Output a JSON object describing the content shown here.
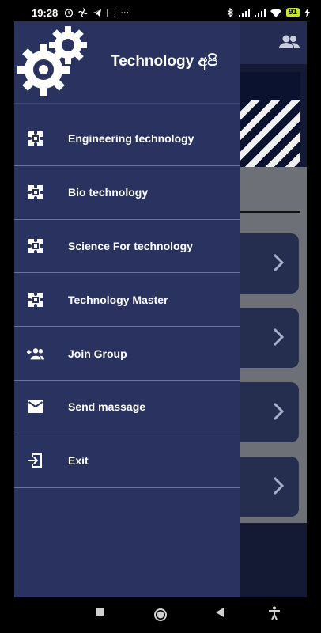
{
  "status_bar": {
    "time": "19:28",
    "left_icons": [
      "alarm-icon",
      "fan-icon",
      "telegram-icon",
      "app-icon",
      "more-icon"
    ],
    "more": "···",
    "battery": "91",
    "right_icons": [
      "bluetooth-icon",
      "signal-icon",
      "signal-icon",
      "wifi-icon",
      "battery-icon",
      "charging-icon"
    ]
  },
  "drawer": {
    "title": "Technology අපි",
    "logo": "gears-logo",
    "items": [
      {
        "label": "Engineering technology",
        "icon": "puzzle-icon"
      },
      {
        "label": "Bio technology",
        "icon": "puzzle-icon"
      },
      {
        "label": "Science For technology",
        "icon": "puzzle-icon"
      },
      {
        "label": "Technology Master",
        "icon": "puzzle-icon"
      },
      {
        "label": "Join Group",
        "icon": "group-add-icon"
      },
      {
        "label": "Send massage",
        "icon": "mail-icon"
      },
      {
        "label": "Exit",
        "icon": "exit-icon"
      }
    ]
  },
  "background": {
    "topbar_icon": "people-icon",
    "cards": 4
  },
  "nav_bar": {
    "buttons": [
      "recents-square-icon",
      "home-circle-icon",
      "back-triangle-icon",
      "accessibility-icon"
    ]
  },
  "colors": {
    "drawer": "#2a3360",
    "divider": "#6a73a0",
    "app_bg": "#141a33",
    "battery": "#c6e23a"
  }
}
